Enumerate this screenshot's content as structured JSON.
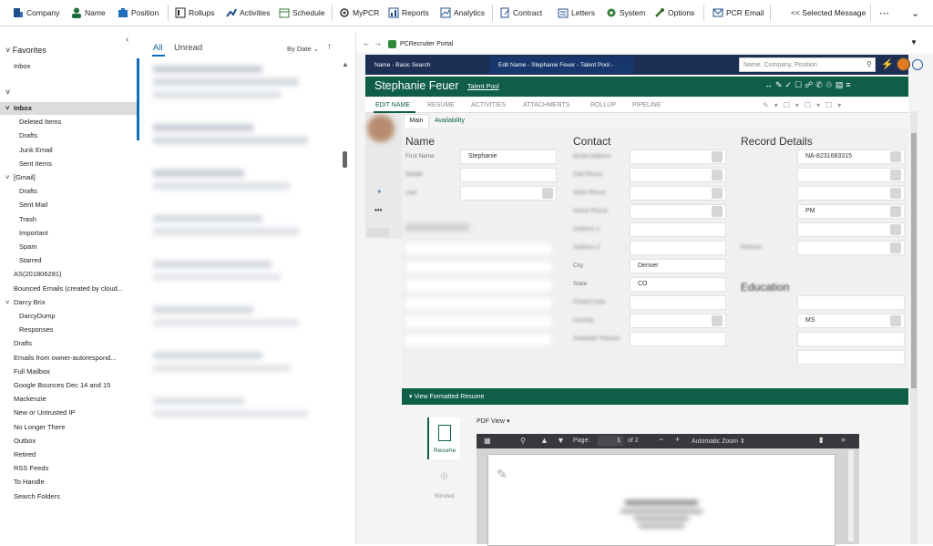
{
  "ribbon": {
    "items": [
      "Company",
      "Name",
      "Position",
      "Rollups",
      "Activities",
      "Schedule",
      "MyPCR",
      "Reports",
      "Analytics",
      "Contract",
      "Letters",
      "System",
      "Options",
      "PCR Email",
      "<< Selected Message"
    ],
    "more": "⋯",
    "chevron": "⌄"
  },
  "folders": {
    "collapse_glyph": "‹",
    "favorites_header": "Favorites",
    "favorites": [
      "Inbox"
    ],
    "account_header": "",
    "items": [
      {
        "label": "Inbox",
        "level": 0,
        "selected": true,
        "bold": true,
        "toggle": "˅"
      },
      {
        "label": "Deleted Items",
        "level": 1
      },
      {
        "label": "Drafts",
        "level": 1
      },
      {
        "label": "Junk Email",
        "level": 1
      },
      {
        "label": "Sent Items",
        "level": 1
      },
      {
        "label": "[Gmail]",
        "level": 0,
        "toggle": "˅"
      },
      {
        "label": "Drafts",
        "level": 1
      },
      {
        "label": "Sent Mail",
        "level": 1
      },
      {
        "label": "Trash",
        "level": 1
      },
      {
        "label": "Important",
        "level": 1
      },
      {
        "label": "Spam",
        "level": 1
      },
      {
        "label": "Starred",
        "level": 1
      },
      {
        "label": "AS(201806281)",
        "level": 0
      },
      {
        "label": "Bounced Emails (created by cloud...",
        "level": 0
      },
      {
        "label": "Darcy Brix",
        "level": 0,
        "toggle": "˅"
      },
      {
        "label": "DarcyDump",
        "level": 1
      },
      {
        "label": "Responses",
        "level": 1
      },
      {
        "label": "Drafts",
        "level": 0
      },
      {
        "label": "Emails from owner-autorespond...",
        "level": 0
      },
      {
        "label": "Full Mailbox",
        "level": 0
      },
      {
        "label": "Google Bounces Dec 14 and 15",
        "level": 0
      },
      {
        "label": "Mackenzie",
        "level": 0
      },
      {
        "label": "New or Untrusted IP",
        "level": 0
      },
      {
        "label": "No Longer There",
        "level": 0
      },
      {
        "label": "Outbox",
        "level": 0
      },
      {
        "label": "Retired",
        "level": 0
      },
      {
        "label": "RSS Feeds",
        "level": 0
      },
      {
        "label": "To Handle",
        "level": 0
      },
      {
        "label": "Search Folders",
        "level": 0
      }
    ]
  },
  "messages": {
    "tab_all": "All",
    "tab_unread": "Unread",
    "sort": "By Date ⌄",
    "sort_arrow": "↑"
  },
  "pcr": {
    "portal_title": "PCRecruiter Portal",
    "nav_back": "←",
    "nav_fwd": "→",
    "tabs": [
      "Name - Basic Search",
      "Edit Name - Stephanie Feuer - Talent Pool -"
    ],
    "search_placeholder": "Name, Company, Position",
    "record_name": "Stephanie Feuer",
    "record_link": "Talent Pool",
    "subtabs": [
      "EDIT NAME",
      "RESUME",
      "ACTIVITIES",
      "ATTACHMENTS",
      "ROLLUP",
      "PIPELINE"
    ],
    "subsubtabs": [
      "Main",
      "Availability"
    ],
    "more_dots": "•••",
    "sections": {
      "name": "Name",
      "contact": "Contact",
      "record": "Record Details",
      "education": "Education"
    },
    "name_fields": [
      {
        "label": "First Name",
        "value": "Stephanie"
      },
      {
        "label": "Middle",
        "value": ""
      },
      {
        "label": "Last",
        "value": ""
      }
    ],
    "contact_fields": [
      {
        "label": "Email Address",
        "value": ""
      },
      {
        "label": "Cell Phone",
        "value": ""
      },
      {
        "label": "Work Phone",
        "value": ""
      },
      {
        "label": "Home Phone",
        "value": ""
      },
      {
        "label": "Address 1",
        "value": ""
      },
      {
        "label": "Address 2",
        "value": ""
      },
      {
        "label": "City",
        "value": "Denver"
      },
      {
        "label": "State",
        "value": "CO"
      },
      {
        "label": "Postal Code",
        "value": ""
      },
      {
        "label": "Country",
        "value": ""
      },
      {
        "label": "Available Timeout",
        "value": ""
      }
    ],
    "record_fields": [
      {
        "label": "",
        "value": "NA-8231683315"
      },
      {
        "label": "",
        "value": ""
      },
      {
        "label": "",
        "value": ""
      },
      {
        "label": "",
        "value": "PM"
      },
      {
        "label": "",
        "value": ""
      },
      {
        "label": "Referrer",
        "value": ""
      }
    ],
    "education_fields": [
      {
        "label": "",
        "value": ""
      },
      {
        "label": "",
        "value": "MS"
      },
      {
        "label": "",
        "value": ""
      },
      {
        "label": "",
        "value": ""
      }
    ],
    "resume_header": "View Formatted Resume",
    "resume_side": [
      "Resume",
      "Blinded"
    ],
    "pdf_view": "PDF View",
    "pdf_page_label": "Page:",
    "pdf_page": "1",
    "pdf_of": "of 2",
    "pdf_zoom": "Automatic Zoom"
  },
  "colors": {
    "brand_green": "#0f5e48",
    "tab_blue": "#17366b",
    "tab_dark": "#1e2f55"
  }
}
